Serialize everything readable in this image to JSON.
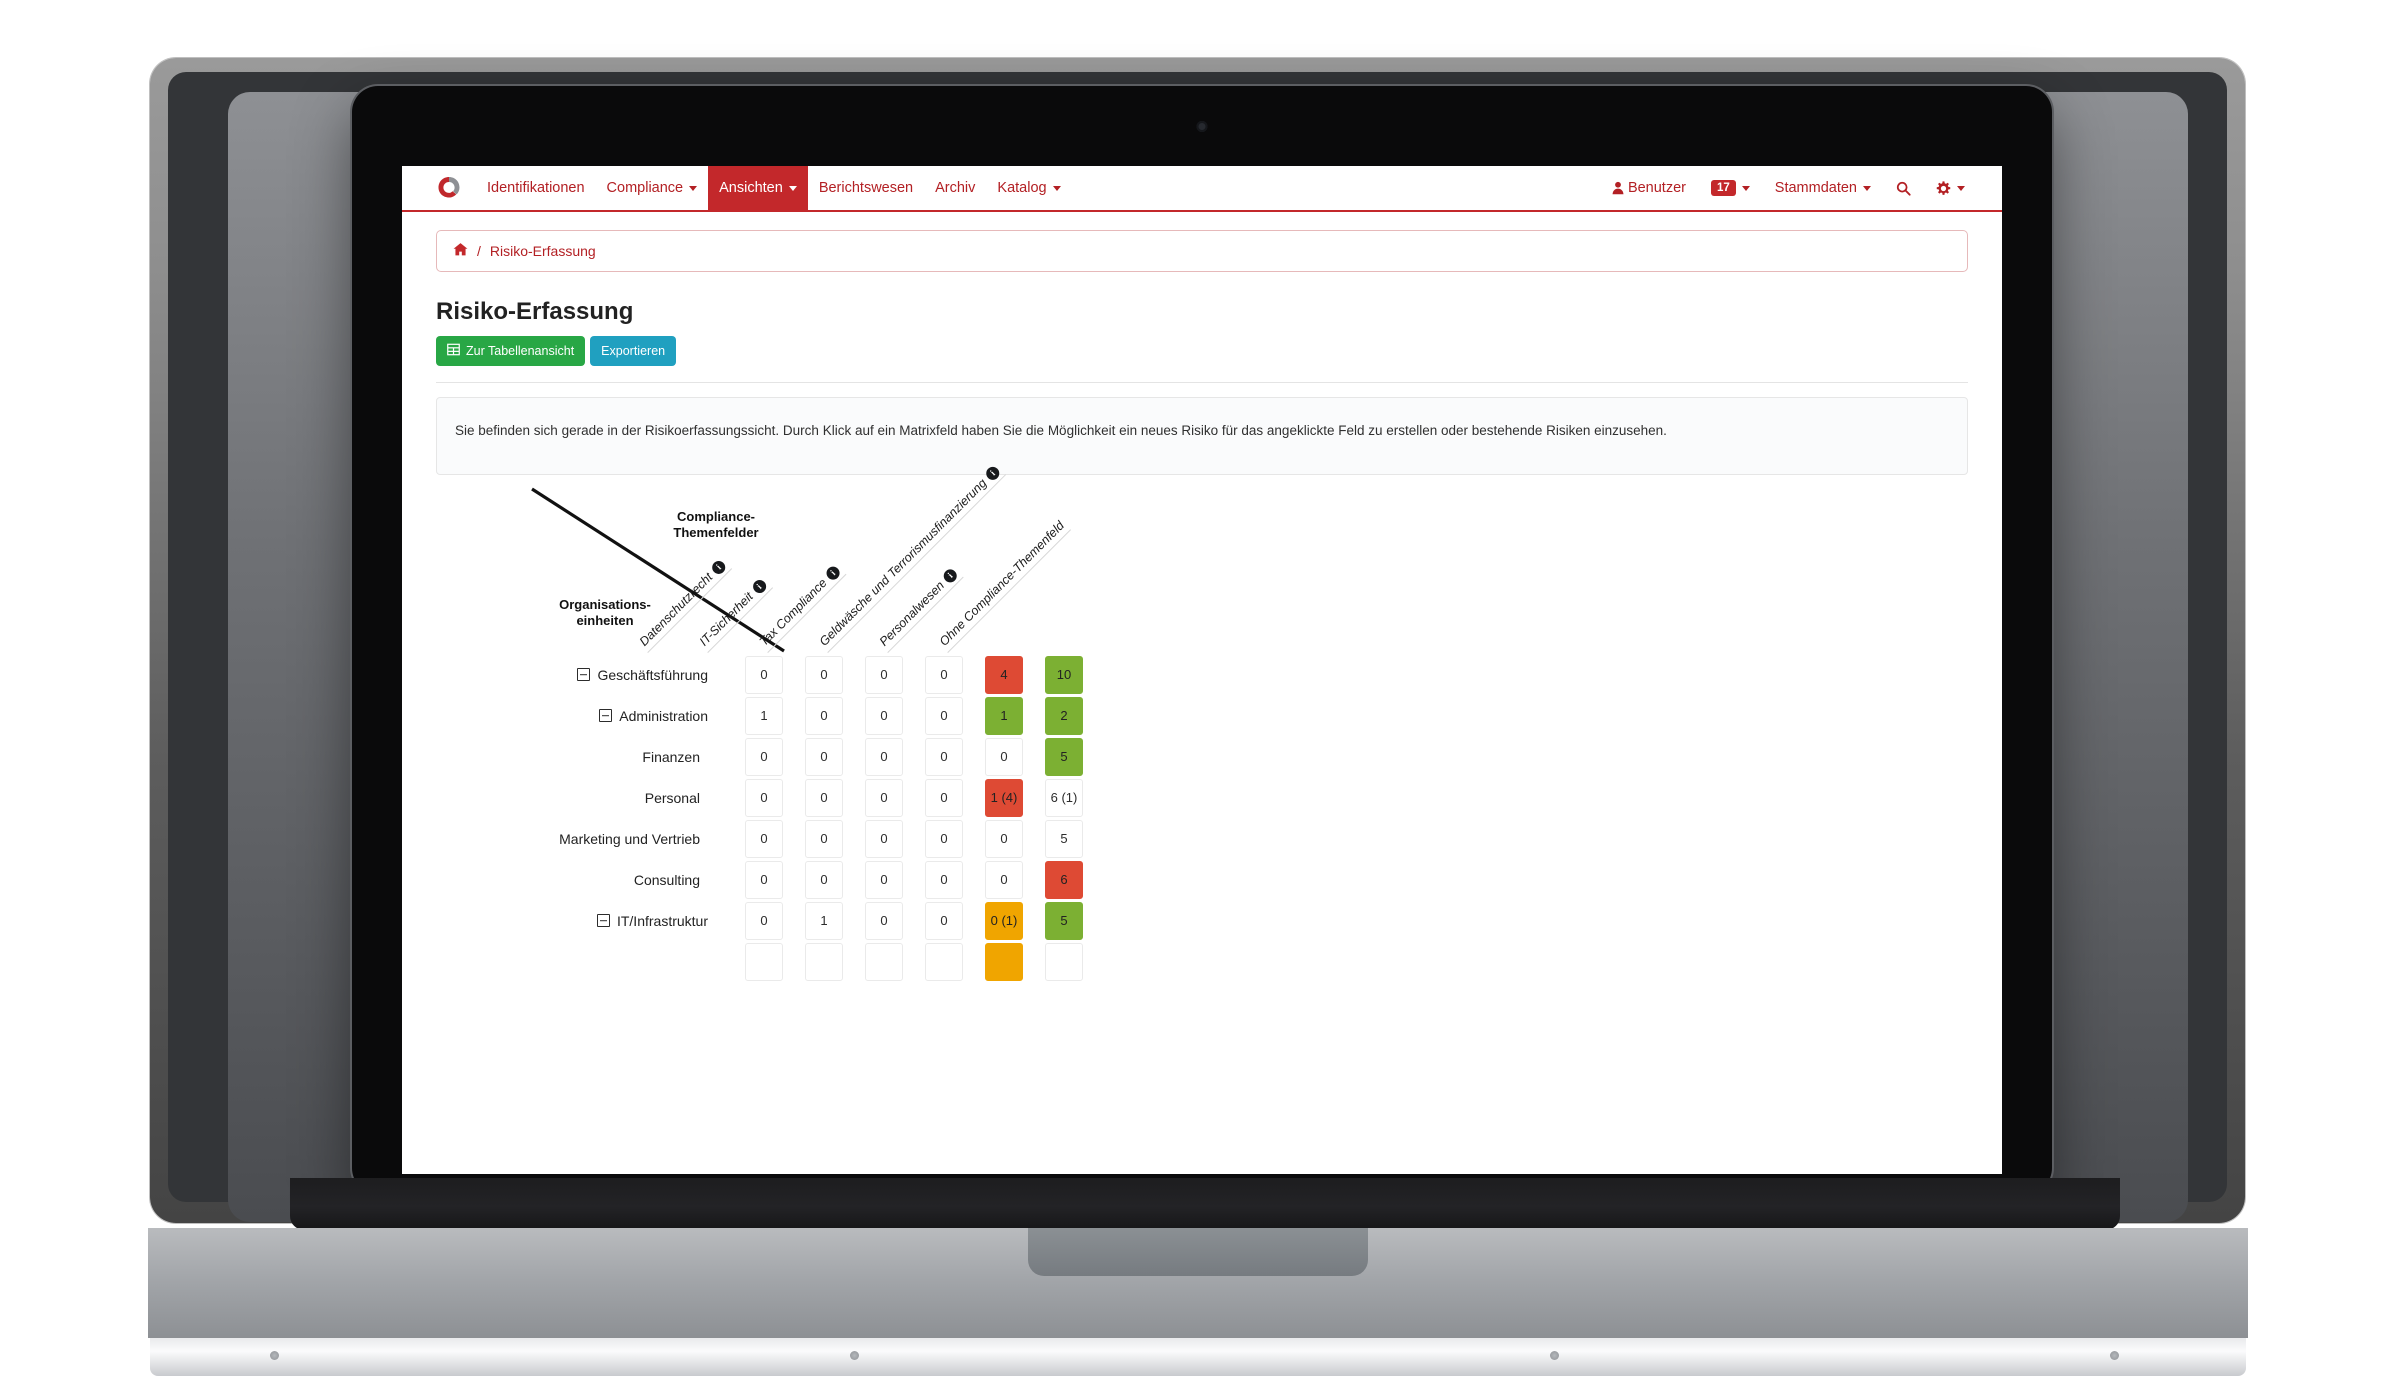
{
  "navbar": {
    "brand": "logo-icon",
    "left_items": [
      {
        "label": "Identifikationen",
        "dropdown": false,
        "active": false
      },
      {
        "label": "Compliance",
        "dropdown": true,
        "active": false
      },
      {
        "label": "Ansichten",
        "dropdown": true,
        "active": true
      },
      {
        "label": "Berichtswesen",
        "dropdown": false,
        "active": false
      },
      {
        "label": "Archiv",
        "dropdown": false,
        "active": false
      },
      {
        "label": "Katalog",
        "dropdown": true,
        "active": false
      }
    ],
    "user_label": "Benutzer",
    "badge_count": "17",
    "stammdaten_label": "Stammdaten",
    "search_icon": "search-icon",
    "gear_icon": "gear-icon",
    "accent_color": "#c3282b"
  },
  "breadcrumb": {
    "home_icon": "home-icon",
    "separator": "/",
    "current": "Risiko-Erfassung"
  },
  "page": {
    "title": "Risiko-Erfassung",
    "buttons": {
      "table_view": "Zur Tabellenansicht",
      "export": "Exportieren"
    },
    "info_text": "Sie befinden sich gerade in der Risikoerfassungssicht. Durch Klick auf ein Matrixfeld haben Sie die Möglichkeit ein neues Risiko für das angeklickte Feld zu erstellen oder bestehende Risiken einzusehen."
  },
  "matrix": {
    "corner_top_label": "Compliance-\nThemenfelder",
    "corner_top_line1": "Compliance-",
    "corner_top_line2": "Themenfelder",
    "corner_bottom_line1": "Organisations-",
    "corner_bottom_line2": "einheiten",
    "columns": [
      {
        "label": "Datenschutzrecht",
        "info": true
      },
      {
        "label": "IT-Sicherheit",
        "info": true
      },
      {
        "label": "Tax Compliance",
        "info": true
      },
      {
        "label": "Geldwäsche und Terrorismusfinanzierung",
        "info": true
      },
      {
        "label": "Personalwesen",
        "info": true
      },
      {
        "label": "Ohne Compliance-Themenfeld",
        "info": false
      }
    ],
    "rows": [
      {
        "label": "Geschäftsführung",
        "collapsible": true,
        "indent": 0,
        "cells": [
          {
            "v": "0",
            "c": "none"
          },
          {
            "v": "0",
            "c": "none"
          },
          {
            "v": "0",
            "c": "none"
          },
          {
            "v": "0",
            "c": "none"
          },
          {
            "v": "4",
            "c": "red"
          },
          {
            "v": "10",
            "c": "green"
          }
        ]
      },
      {
        "label": "Administration",
        "collapsible": true,
        "indent": 1,
        "cells": [
          {
            "v": "1",
            "c": "none"
          },
          {
            "v": "0",
            "c": "none"
          },
          {
            "v": "0",
            "c": "none"
          },
          {
            "v": "0",
            "c": "none"
          },
          {
            "v": "1",
            "c": "green"
          },
          {
            "v": "2",
            "c": "green"
          }
        ]
      },
      {
        "label": "Finanzen",
        "collapsible": false,
        "indent": 2,
        "cells": [
          {
            "v": "0",
            "c": "none"
          },
          {
            "v": "0",
            "c": "none"
          },
          {
            "v": "0",
            "c": "none"
          },
          {
            "v": "0",
            "c": "none"
          },
          {
            "v": "0",
            "c": "none"
          },
          {
            "v": "5",
            "c": "green"
          }
        ]
      },
      {
        "label": "Personal",
        "collapsible": false,
        "indent": 2,
        "cells": [
          {
            "v": "0",
            "c": "none"
          },
          {
            "v": "0",
            "c": "none"
          },
          {
            "v": "0",
            "c": "none"
          },
          {
            "v": "0",
            "c": "none"
          },
          {
            "v": "1 (4)",
            "c": "red"
          },
          {
            "v": "6 (1)",
            "c": "none"
          }
        ]
      },
      {
        "label": "Marketing und Vertrieb",
        "collapsible": false,
        "indent": 2,
        "cells": [
          {
            "v": "0",
            "c": "none"
          },
          {
            "v": "0",
            "c": "none"
          },
          {
            "v": "0",
            "c": "none"
          },
          {
            "v": "0",
            "c": "none"
          },
          {
            "v": "0",
            "c": "none"
          },
          {
            "v": "5",
            "c": "none"
          }
        ]
      },
      {
        "label": "Consulting",
        "collapsible": false,
        "indent": 2,
        "cells": [
          {
            "v": "0",
            "c": "none"
          },
          {
            "v": "0",
            "c": "none"
          },
          {
            "v": "0",
            "c": "none"
          },
          {
            "v": "0",
            "c": "none"
          },
          {
            "v": "0",
            "c": "none"
          },
          {
            "v": "6",
            "c": "red"
          }
        ]
      },
      {
        "label": "IT/Infrastruktur",
        "collapsible": true,
        "indent": 1,
        "cells": [
          {
            "v": "0",
            "c": "none"
          },
          {
            "v": "1",
            "c": "none"
          },
          {
            "v": "0",
            "c": "none"
          },
          {
            "v": "0",
            "c": "none"
          },
          {
            "v": "0 (1)",
            "c": "orange"
          },
          {
            "v": "5",
            "c": "green"
          }
        ]
      },
      {
        "label": "",
        "collapsible": false,
        "indent": 2,
        "cells": [
          {
            "v": "",
            "c": "none"
          },
          {
            "v": "",
            "c": "none"
          },
          {
            "v": "",
            "c": "none"
          },
          {
            "v": "",
            "c": "none"
          },
          {
            "v": "",
            "c": "orange"
          },
          {
            "v": "",
            "c": "none"
          }
        ]
      }
    ],
    "colors": {
      "red": "#de4a34",
      "green": "#7cb033",
      "orange": "#f0a500",
      "empty": "#ffffff"
    }
  }
}
